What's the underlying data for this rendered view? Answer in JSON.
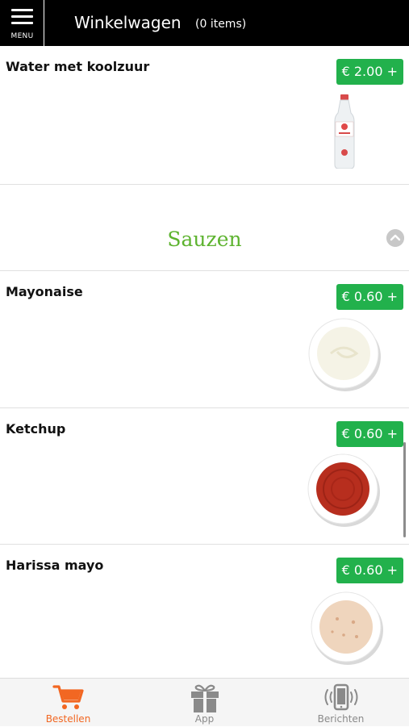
{
  "header": {
    "menu_label": "MENU",
    "title": "Winkelwagen",
    "item_count": "(0 items)"
  },
  "products": [
    {
      "name": "Water met koolzuur",
      "price": "€ 2.00 +",
      "image": "sparkling-water-bottle"
    },
    {
      "name": "Mayonaise",
      "price": "€ 0.60 +",
      "image": "mayonnaise-bowl"
    },
    {
      "name": "Ketchup",
      "price": "€ 0.60 +",
      "image": "ketchup-bowl"
    },
    {
      "name": "Harissa mayo",
      "price": "€ 0.60 +",
      "image": "harissa-mayo-bowl"
    }
  ],
  "category": {
    "title": "Sauzen",
    "collapse_icon": "chevron-up-icon"
  },
  "tabs": [
    {
      "label": "Bestellen",
      "icon": "cart-icon",
      "active": true
    },
    {
      "label": "App",
      "icon": "gift-icon",
      "active": false
    },
    {
      "label": "Berichten",
      "icon": "phone-vibrate-icon",
      "active": false
    }
  ],
  "colors": {
    "header_bg": "#000000",
    "price_button": "#22b14c",
    "category_title": "#5db32f",
    "active_tab": "#f26722",
    "inactive_tab": "#8a8a8a"
  }
}
